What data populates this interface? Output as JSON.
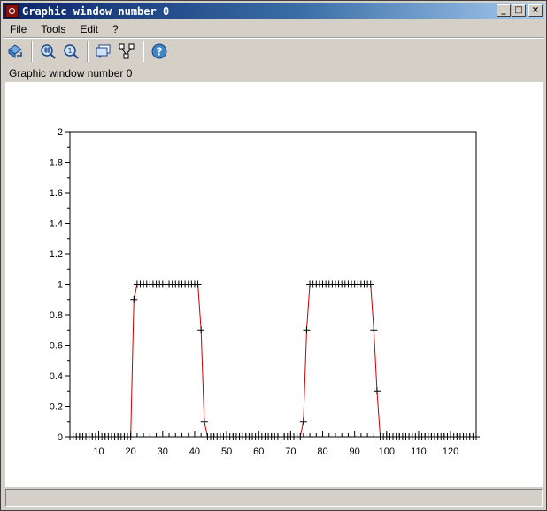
{
  "window": {
    "title": "Graphic window number 0",
    "controls": {
      "minimize": "_",
      "maximize": "□",
      "close": "×"
    }
  },
  "menu": {
    "items": [
      "File",
      "Tools",
      "Edit",
      "?"
    ]
  },
  "toolbar": {
    "icons": [
      "rotate-icon",
      "zoom-in-icon",
      "zoom-out-icon",
      "datatip-icon",
      "edit-icon",
      "help-icon"
    ]
  },
  "info": {
    "label": "Graphic window number 0"
  },
  "status": {
    "text": ""
  },
  "colors": {
    "curve": "#cc0000",
    "marker": "#000000",
    "title_gradient_start": "#0a246a",
    "title_gradient_end": "#a6caf0"
  },
  "chart_data": {
    "type": "line",
    "title": "",
    "xlabel": "",
    "ylabel": "",
    "xlim": [
      1,
      128
    ],
    "ylim": [
      0,
      2
    ],
    "xticks": [
      10,
      20,
      30,
      40,
      50,
      60,
      70,
      80,
      90,
      100,
      110,
      120
    ],
    "xtick_labels": [
      "10",
      "20",
      "30",
      "40",
      "50",
      "60",
      "70",
      "80",
      "90",
      "100",
      "110",
      "120"
    ],
    "yticks": [
      0,
      0.2,
      0.4,
      0.6,
      0.8,
      1,
      1.2,
      1.4,
      1.6,
      1.8,
      2
    ],
    "ytick_labels": [
      "0",
      "0.2",
      "0.4",
      "0.6",
      "0.8",
      "1",
      "1.2",
      "1.4",
      "1.6",
      "1.8",
      "2"
    ],
    "grid": false,
    "legend": "none",
    "series": [
      {
        "marker": "+",
        "x": [
          1,
          2,
          3,
          4,
          5,
          6,
          7,
          8,
          9,
          10,
          11,
          12,
          13,
          14,
          15,
          16,
          17,
          18,
          19,
          20,
          21,
          22,
          23,
          24,
          25,
          26,
          27,
          28,
          29,
          30,
          31,
          32,
          33,
          34,
          35,
          36,
          37,
          38,
          39,
          40,
          41,
          42,
          43,
          44,
          45,
          46,
          47,
          48,
          49,
          50,
          51,
          52,
          53,
          54,
          55,
          56,
          57,
          58,
          59,
          60,
          61,
          62,
          63,
          64,
          65,
          66,
          67,
          68,
          69,
          70,
          71,
          72,
          73,
          74,
          75,
          76,
          77,
          78,
          79,
          80,
          81,
          82,
          83,
          84,
          85,
          86,
          87,
          88,
          89,
          90,
          91,
          92,
          93,
          94,
          95,
          96,
          97,
          98,
          99,
          100,
          101,
          102,
          103,
          104,
          105,
          106,
          107,
          108,
          109,
          110,
          111,
          112,
          113,
          114,
          115,
          116,
          117,
          118,
          119,
          120,
          121,
          122,
          123,
          124,
          125,
          126,
          127,
          128
        ],
        "y": [
          0,
          0,
          0,
          0,
          0,
          0,
          0,
          0,
          0,
          0,
          0,
          0,
          0,
          0,
          0,
          0,
          0,
          0,
          0,
          0,
          0.9,
          1,
          1,
          1,
          1,
          1,
          1,
          1,
          1,
          1,
          1,
          1,
          1,
          1,
          1,
          1,
          1,
          1,
          1,
          1,
          1,
          0.7,
          0.1,
          0,
          0,
          0,
          0,
          0,
          0,
          0,
          0,
          0,
          0,
          0,
          0,
          0,
          0,
          0,
          0,
          0,
          0,
          0,
          0,
          0,
          0,
          0,
          0,
          0,
          0,
          0,
          0,
          0,
          0,
          0.1,
          0.7,
          1,
          1,
          1,
          1,
          1,
          1,
          1,
          1,
          1,
          1,
          1,
          1,
          1,
          1,
          1,
          1,
          1,
          1,
          1,
          1,
          0.7,
          0.3,
          0,
          0,
          0,
          0,
          0,
          0,
          0,
          0,
          0,
          0,
          0,
          0,
          0,
          0,
          0,
          0,
          0,
          0,
          0,
          0,
          0,
          0,
          0,
          0,
          0,
          0,
          0,
          0,
          0,
          0,
          0
        ]
      }
    ]
  }
}
